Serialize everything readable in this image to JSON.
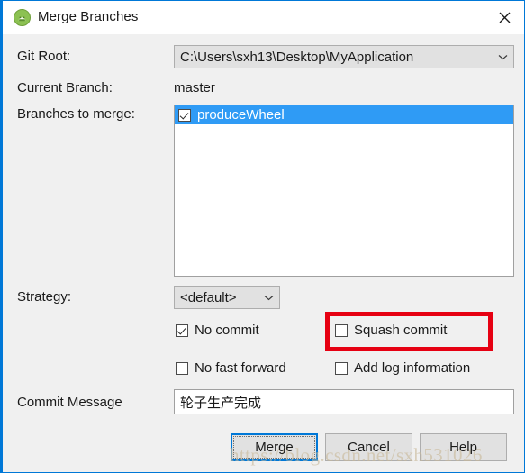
{
  "window": {
    "title": "Merge Branches",
    "app_icon": "android-studio-icon",
    "close_icon": "close-icon",
    "accent_color": "#0078d7"
  },
  "form": {
    "git_root": {
      "label": "Git Root:",
      "value": "C:\\Users\\sxh13\\Desktop\\MyApplication",
      "dropdown_icon": "chevron-down-icon"
    },
    "current_branch": {
      "label": "Current Branch:",
      "value": "master"
    },
    "branches_to_merge": {
      "label": "Branches to merge:",
      "items": [
        {
          "name": "produceWheel",
          "checked": true,
          "selected": true
        }
      ]
    },
    "strategy": {
      "label": "Strategy:",
      "value": "<default>",
      "dropdown_icon": "chevron-down-icon"
    },
    "options": [
      {
        "label": "No commit",
        "checked": true
      },
      {
        "label": "Squash commit",
        "checked": false
      },
      {
        "label": "No fast forward",
        "checked": false
      },
      {
        "label": "Add log information",
        "checked": false
      }
    ],
    "commit_message": {
      "label": "Commit Message",
      "value": "轮子生产完成",
      "placeholder": ""
    }
  },
  "annotation": {
    "color": "#e60012",
    "target": "Squash commit"
  },
  "buttons": [
    {
      "label": "Merge",
      "focused": true
    },
    {
      "label": "Cancel",
      "focused": false
    },
    {
      "label": "Help",
      "focused": false
    }
  ],
  "watermark": {
    "text": "https://blog.csdn.net/sxh531026"
  }
}
